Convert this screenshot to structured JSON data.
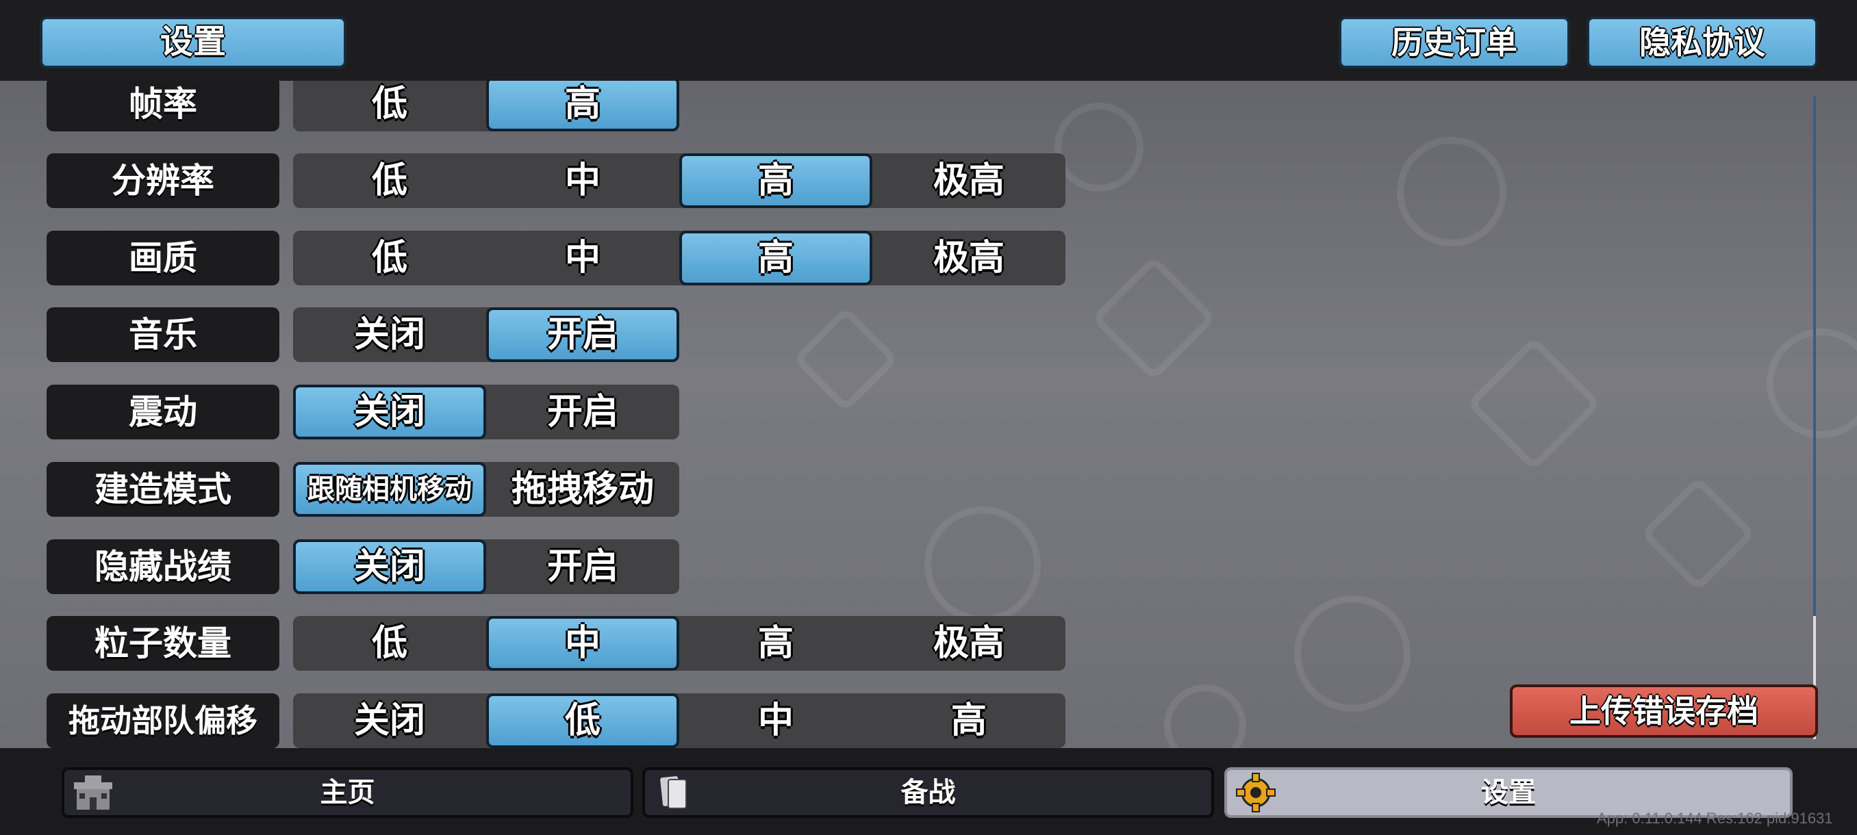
{
  "header": {
    "title": "设置",
    "history_orders": "历史订单",
    "privacy_policy": "隐私协议"
  },
  "settings": [
    {
      "label": "帧率",
      "options": [
        "低",
        "高"
      ],
      "selected": "高"
    },
    {
      "label": "分辨率",
      "options": [
        "低",
        "中",
        "高",
        "极高"
      ],
      "selected": "高"
    },
    {
      "label": "画质",
      "options": [
        "低",
        "中",
        "高",
        "极高"
      ],
      "selected": "高"
    },
    {
      "label": "音乐",
      "options": [
        "关闭",
        "开启"
      ],
      "selected": "开启"
    },
    {
      "label": "震动",
      "options": [
        "关闭",
        "开启"
      ],
      "selected": "关闭"
    },
    {
      "label": "建造模式",
      "options": [
        "跟随相机移动",
        "拖拽移动"
      ],
      "selected": "跟随相机移动"
    },
    {
      "label": "隐藏战绩",
      "options": [
        "关闭",
        "开启"
      ],
      "selected": "关闭"
    },
    {
      "label": "粒子数量",
      "options": [
        "低",
        "中",
        "高",
        "极高"
      ],
      "selected": "中"
    },
    {
      "label": "拖动部队偏移",
      "options": [
        "关闭",
        "低",
        "中",
        "高"
      ],
      "selected": "低"
    }
  ],
  "upload_error_save": "上传错误存档",
  "bottom_nav": [
    {
      "label": "主页",
      "icon": "castle-icon",
      "active": false
    },
    {
      "label": "备战",
      "icon": "cards-icon",
      "active": false
    },
    {
      "label": "设置",
      "icon": "gear-icon",
      "active": true
    }
  ],
  "version_text": "App: 0.11.0.144 Res:162 pid:91631",
  "colors": {
    "selected": "#5aa7d5",
    "danger": "#c44a3e",
    "bar": "#1d1d1f"
  }
}
